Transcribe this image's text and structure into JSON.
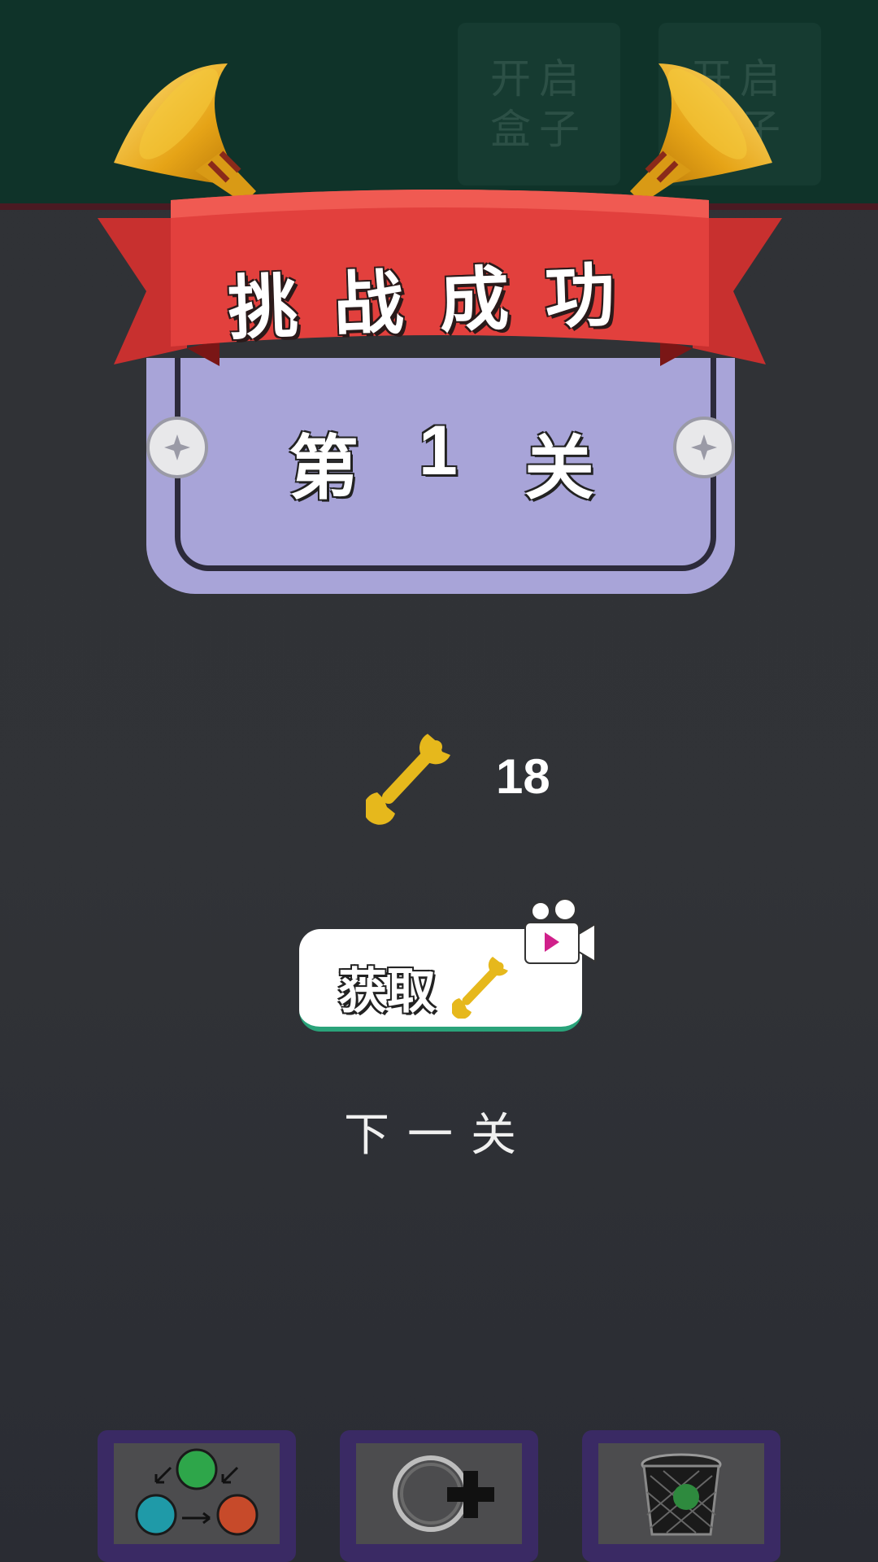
{
  "top_bar": {
    "buttons": [
      {
        "line1": "开启",
        "line2": "盒子"
      },
      {
        "line1": "开启",
        "line2": "盒子"
      }
    ]
  },
  "banner": {
    "title": "挑战成功"
  },
  "level": {
    "prefix": "第",
    "number": "1",
    "suffix": "关"
  },
  "reward": {
    "wrench_count": "18"
  },
  "get_button": {
    "label": "获取"
  },
  "next_level": {
    "label": "下一关"
  },
  "tools": [
    {
      "icon": "swap-colors-icon"
    },
    {
      "icon": "add-ring-icon"
    },
    {
      "icon": "trash-bin-icon"
    }
  ]
}
